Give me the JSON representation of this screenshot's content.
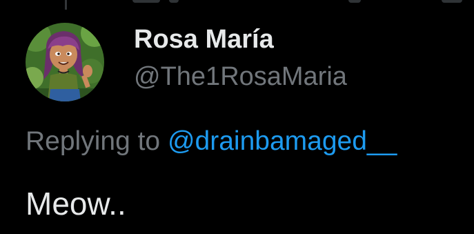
{
  "tweet": {
    "author": {
      "display_name": "Rosa María",
      "handle": "@The1RosaMaria",
      "avatar_icon": "cartoon-avatar"
    },
    "reply": {
      "prefix": "Replying to",
      "mention": "@drainbamaged__"
    },
    "text": "Meow.."
  },
  "colors": {
    "background": "#000000",
    "primary_text": "#e7e9ea",
    "secondary_text": "#71767b",
    "link": "#1d9bf0"
  }
}
